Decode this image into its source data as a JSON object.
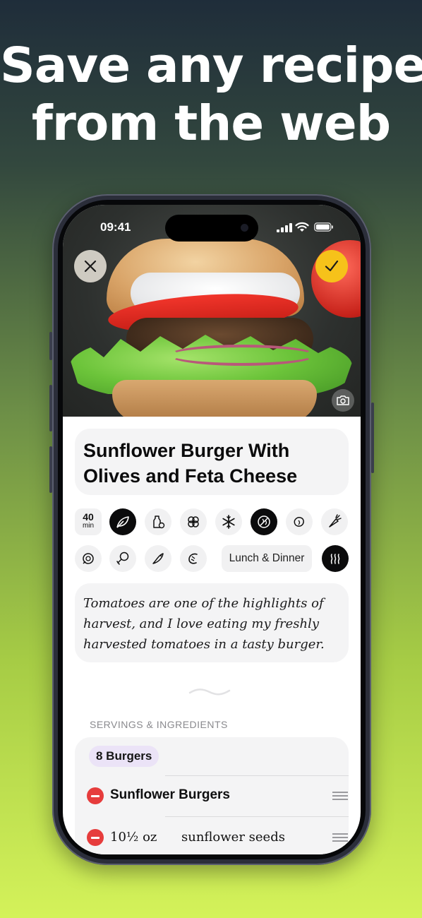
{
  "headline": {
    "line1": "Save any recipe",
    "line2": "from the web"
  },
  "status_bar": {
    "time": "09:41"
  },
  "recipe": {
    "title": "Sunflower Burger With Olives and Feta Cheese",
    "time_value": "40",
    "time_unit": "min",
    "meal_tag": "Lunch & Dinner",
    "description": "Tomatoes are one of the highlights of harvest, and I love eating my freshly harvested tomatoes in a tasty burger.",
    "diet_icons": [
      "leaf-icon",
      "milk-free-icon",
      "egg-free-icon",
      "snowflake-icon",
      "gluten-free-icon",
      "nut-free-icon",
      "vegetable-icon",
      "sunflower-icon",
      "drumstick-icon",
      "fish-icon",
      "shrimp-icon",
      "steam-icon"
    ]
  },
  "ingredients_section": {
    "label": "SERVINGS & INGREDIENTS",
    "servings": "8 Burgers",
    "group_title": "Sunflower Burgers",
    "items": [
      {
        "qty": "10½ oz",
        "name": "sunflower seeds"
      }
    ]
  },
  "colors": {
    "accent_yellow": "#f6c21a",
    "delete_red": "#e63c3c",
    "servings_pill": "#ebe3f7"
  }
}
